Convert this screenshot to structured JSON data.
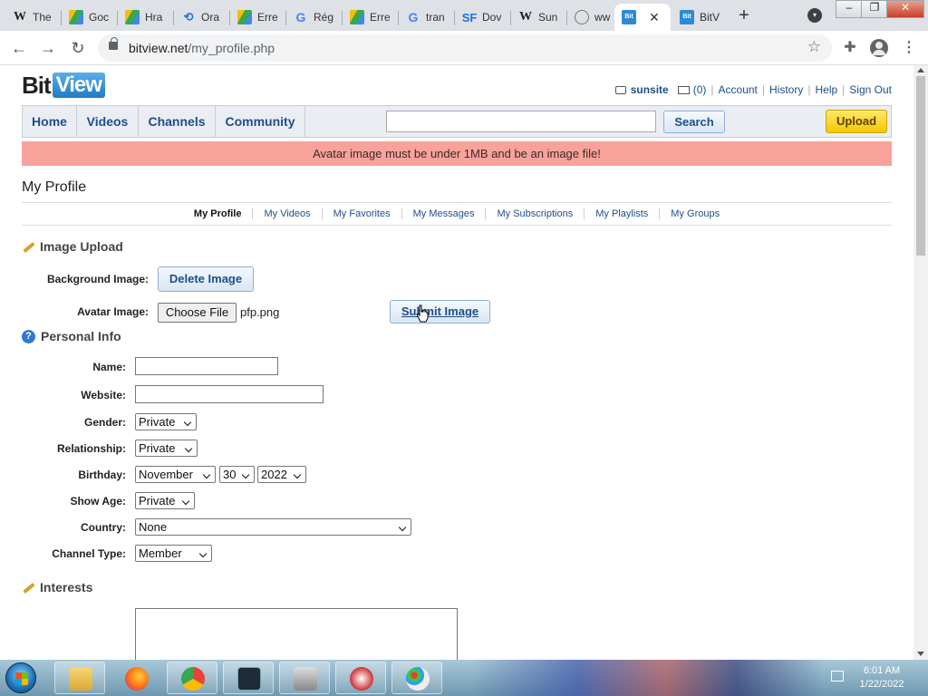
{
  "browser": {
    "tabs": [
      {
        "label": "The",
        "icon": "wikipedia-icon"
      },
      {
        "label": "Goc",
        "icon": "google-drive-icon"
      },
      {
        "label": "Hra",
        "icon": "google-drive-icon"
      },
      {
        "label": "Ora",
        "icon": "sync-icon"
      },
      {
        "label": "Erre",
        "icon": "google-drive-icon"
      },
      {
        "label": "Rég",
        "icon": "google-icon"
      },
      {
        "label": "Erre",
        "icon": "google-drive-icon"
      },
      {
        "label": "tran",
        "icon": "google-icon"
      },
      {
        "label": "Dov",
        "icon": "sf-icon"
      },
      {
        "label": "Sun",
        "icon": "wikipedia-icon"
      },
      {
        "label": "ww",
        "icon": "globe-icon"
      },
      {
        "label": "",
        "icon": "bitview-icon",
        "active": true
      },
      {
        "label": "BitV",
        "icon": "bitview-icon"
      }
    ],
    "url_domain": "bitview.net",
    "url_path": "/my_profile.php"
  },
  "site": {
    "logo_bit": "Bit",
    "logo_view": "View",
    "username": "sunsite",
    "messages_count": "(0)",
    "links": [
      "Account",
      "History",
      "Help",
      "Sign Out"
    ],
    "nav": [
      "Home",
      "Videos",
      "Channels",
      "Community"
    ],
    "search_label": "Search",
    "upload_label": "Upload",
    "search_value": ""
  },
  "error_message": "Avatar image must be under 1MB and be an image file!",
  "page_title": "My Profile",
  "subnav": [
    {
      "label": "My Profile",
      "current": true
    },
    {
      "label": "My Videos"
    },
    {
      "label": "My Favorites"
    },
    {
      "label": "My Messages"
    },
    {
      "label": "My Subscriptions"
    },
    {
      "label": "My Playlists"
    },
    {
      "label": "My Groups"
    }
  ],
  "image_upload": {
    "heading": "Image Upload",
    "background_label": "Background Image:",
    "delete_label": "Delete Image",
    "avatar_label": "Avatar Image:",
    "choose_file_label": "Choose File",
    "file_name": "pfp.png",
    "submit_label": "Submit Image"
  },
  "personal_info": {
    "heading": "Personal Info",
    "name_label": "Name:",
    "name_value": "",
    "website_label": "Website:",
    "website_value": "",
    "gender_label": "Gender:",
    "gender_value": "Private",
    "relationship_label": "Relationship:",
    "relationship_value": "Private",
    "birthday_label": "Birthday:",
    "birthday_month": "November",
    "birthday_day": "30",
    "birthday_year": "2022",
    "show_age_label": "Show Age:",
    "show_age_value": "Private",
    "country_label": "Country:",
    "country_value": "None",
    "channel_type_label": "Channel Type:",
    "channel_type_value": "Member"
  },
  "interests": {
    "heading": "Interests",
    "value": ""
  },
  "taskbar": {
    "time": "6:01 AM",
    "date": "1/22/2022"
  },
  "colors": {
    "error_bg": "#f9a29b",
    "link": "#1d4f8c",
    "upload_btn": "#f5c800"
  }
}
